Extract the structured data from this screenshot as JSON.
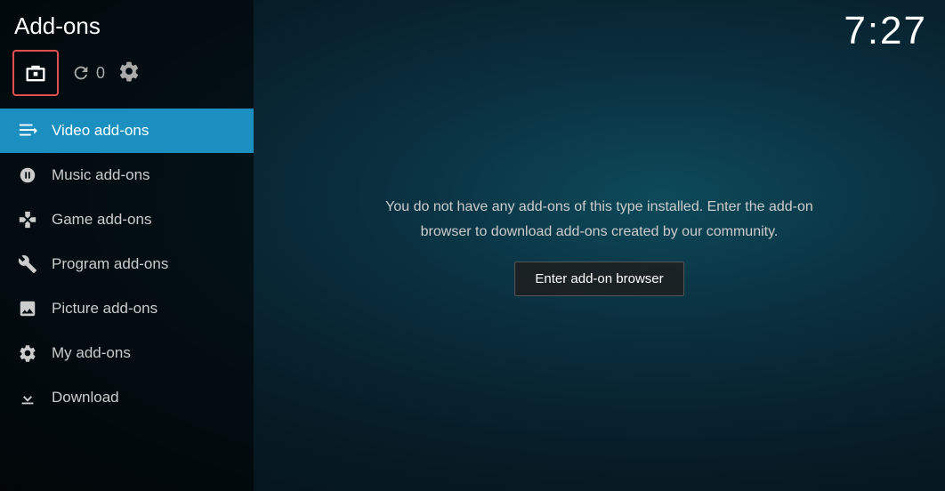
{
  "header": {
    "title": "Add-ons",
    "time": "7:27"
  },
  "icons": {
    "refresh_count": "0"
  },
  "nav": {
    "items": [
      {
        "id": "video",
        "label": "Video add-ons",
        "active": true
      },
      {
        "id": "music",
        "label": "Music add-ons",
        "active": false
      },
      {
        "id": "game",
        "label": "Game add-ons",
        "active": false
      },
      {
        "id": "program",
        "label": "Program add-ons",
        "active": false
      },
      {
        "id": "picture",
        "label": "Picture add-ons",
        "active": false
      },
      {
        "id": "my",
        "label": "My add-ons",
        "active": false
      },
      {
        "id": "download",
        "label": "Download",
        "active": false
      }
    ]
  },
  "main": {
    "empty_message": "You do not have any add-ons of this type installed. Enter the add-on browser to\ndownload add-ons created by our community.",
    "enter_browser_label": "Enter add-on browser"
  }
}
